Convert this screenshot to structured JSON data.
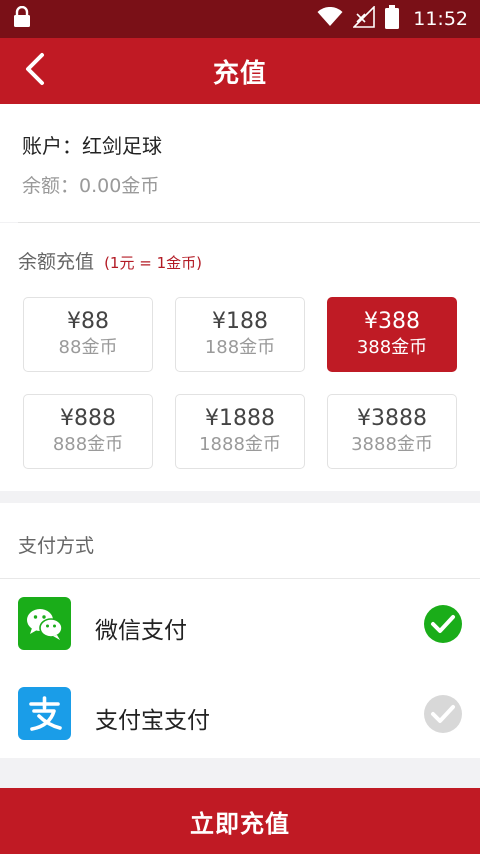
{
  "status_bar": {
    "time": "11:52",
    "icons": [
      "lock-icon",
      "wifi-icon",
      "signal-icon",
      "battery-icon"
    ]
  },
  "titlebar": {
    "title": "充值",
    "back_icon": "chevron-left-icon"
  },
  "account": {
    "name_label": "账户：红剑足球",
    "balance_label": "余额：0.00金币"
  },
  "recharge": {
    "title": "余额充值",
    "note": "(1元 = 1金币)",
    "options": [
      {
        "price": "¥88",
        "coins": "88金币",
        "selected": false
      },
      {
        "price": "¥188",
        "coins": "188金币",
        "selected": false
      },
      {
        "price": "¥388",
        "coins": "388金币",
        "selected": true
      },
      {
        "price": "¥888",
        "coins": "888金币",
        "selected": false
      },
      {
        "price": "¥1888",
        "coins": "1888金币",
        "selected": false
      },
      {
        "price": "¥3888",
        "coins": "3888金币",
        "selected": false
      }
    ]
  },
  "payment": {
    "title": "支付方式",
    "methods": [
      {
        "label": "微信支付",
        "icon": "wechat-icon",
        "checked": true
      },
      {
        "label": "支付宝支付",
        "icon": "alipay-icon",
        "checked": false
      }
    ]
  },
  "submit": {
    "label": "立即充值"
  },
  "colors": {
    "brand_red": "#c01a24",
    "status_dark_red": "#7a1017",
    "wechat_green": "#1aad19",
    "alipay_blue": "#1a9de8",
    "check_green": "#1aad19",
    "check_grey": "#d8d8d8"
  }
}
